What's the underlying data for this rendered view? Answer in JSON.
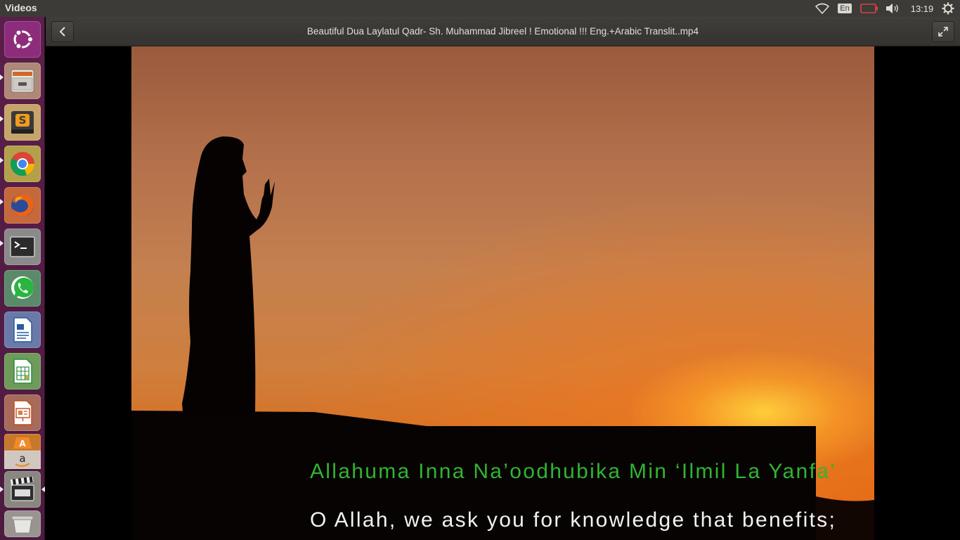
{
  "top_panel": {
    "app_title": "Videos",
    "language": "En",
    "clock": "13:19",
    "icons": [
      "wifi-icon",
      "battery-icon",
      "volume-icon",
      "session-gear-icon"
    ]
  },
  "launcher": {
    "items": [
      {
        "name": "dash-home",
        "icon": "ubuntu-logo-icon",
        "running": false
      },
      {
        "name": "files",
        "icon": "file-cabinet-icon",
        "running": true
      },
      {
        "name": "sublime-text",
        "icon": "sublime-text-icon",
        "running": true
      },
      {
        "name": "chrome",
        "icon": "chrome-icon",
        "running": true
      },
      {
        "name": "firefox",
        "icon": "firefox-icon",
        "running": true
      },
      {
        "name": "terminal",
        "icon": "terminal-icon",
        "running": true
      },
      {
        "name": "whatsapp",
        "icon": "whatsapp-icon",
        "running": false
      },
      {
        "name": "libreoffice-writer",
        "icon": "writer-icon",
        "running": false
      },
      {
        "name": "libreoffice-calc",
        "icon": "calc-icon",
        "running": false
      },
      {
        "name": "libreoffice-impress",
        "icon": "impress-icon",
        "running": false
      },
      {
        "name": "software-center",
        "icon": "software-center-icon",
        "running": false
      },
      {
        "name": "amazon",
        "icon": "amazon-icon",
        "running": false
      },
      {
        "name": "videos",
        "icon": "clapperboard-icon",
        "running": true,
        "active": true
      },
      {
        "name": "trash",
        "icon": "trash-icon",
        "running": false
      }
    ]
  },
  "player": {
    "title": "Beautiful Dua Laylatul Qadr- Sh. Muhammad Jibreel ! Emotional !!! Eng.+Arabic Translit..mp4",
    "back_icon": "chevron-left-icon",
    "fullscreen_icon": "fullscreen-icon"
  },
  "subtitles": {
    "transliteration": "Allahuma Inna Na’oodhubika Min ‘Ilmil La Yanfa’",
    "translation": "O Allah, we ask you for knowledge that benefits;",
    "transliteration_color": "#2fb52f",
    "translation_color": "#f2f2f2"
  },
  "colors": {
    "panel": "#3c3b37",
    "launcher": "#5a1f4a",
    "sky_top": "#9a5a3c",
    "sky_bottom": "#e0560c"
  }
}
